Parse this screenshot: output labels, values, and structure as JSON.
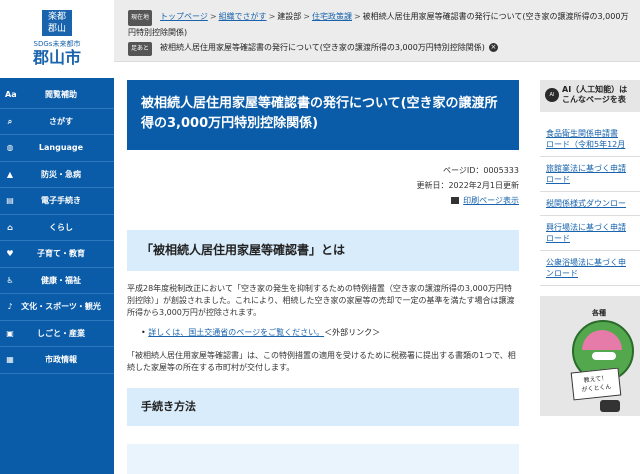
{
  "logo": {
    "mark_text": "楽都\n郡山",
    "sdgs": "SDGs未来都市",
    "name": "郡山市"
  },
  "sidebar": {
    "items": [
      {
        "label": "閲覧補助",
        "icon": "font-size-icon"
      },
      {
        "label": "さがす",
        "icon": "search-icon"
      },
      {
        "label": "Language",
        "icon": "globe-icon"
      },
      {
        "label": "防災・急病",
        "icon": "warning-icon"
      },
      {
        "label": "電子手続き",
        "icon": "document-icon"
      },
      {
        "label": "くらし",
        "icon": "house-icon"
      },
      {
        "label": "子育て・教育",
        "icon": "heart-icon"
      },
      {
        "label": "健康・福祉",
        "icon": "accessibility-icon"
      },
      {
        "label": "文化・スポーツ・観光",
        "icon": "music-note-icon"
      },
      {
        "label": "しごと・産業",
        "icon": "briefcase-icon"
      },
      {
        "label": "市政情報",
        "icon": "building-icon"
      }
    ]
  },
  "breadcrumb": {
    "badge": "現在地",
    "links": [
      "トップページ",
      "組織でさがす",
      "建設部",
      "住宅政策課"
    ],
    "current": "被相続人居住用家屋等確認書の発行について(空き家の譲渡所得の3,000万円特別控除関係)",
    "link_flags": [
      true,
      true,
      false,
      true
    ]
  },
  "from": {
    "badge": "足あと",
    "text": "被相続人居住用家屋等確認書の発行について(空き家の譲渡所得の3,000万円特別控除関係)"
  },
  "article": {
    "title": "被相続人居住用家屋等確認書の発行について(空き家の譲渡所得の3,000万円特別控除関係)",
    "page_id": "ページID：0005333",
    "updated": "更新日：2022年2月1日更新",
    "print_label": "印刷ページ表示",
    "h2": "「被相続人居住用家屋等確認書」とは",
    "para1": "平成28年度税制改正において「空き家の発生を抑制するための特例措置（空き家の譲渡所得の3,000万円特別控除）」が創設されました。これにより、相続した空き家の家屋等の売却で一定の基準を満たす場合は譲渡所得から3,000万円が控除されます。",
    "ext_link": "詳しくは、国土交通省のページをご覧ください。",
    "ext_suffix": "＜外部リンク＞",
    "para2": "「被相続人居住用家屋等確認書」は、この特例措置の適用を受けるために税務署に提出する書類の1つで、相続した家屋等の所在する市町村が交付します。",
    "h3": "手続き方法"
  },
  "right": {
    "ai_icon": "AI",
    "ai_text": "AI（人工知能）は\nこんなページを表",
    "links": [
      "食品衛生関係申請書\nロード（令和5年12月",
      "旅館業法に基づく申請\nロード",
      "税関係様式ダウンロー",
      "興行場法に基づく申請\nロード",
      "公衆浴場法に基づく申\nンロード"
    ],
    "gaku_head": "各種",
    "gaku_sign": "教えて！\nがくとくん"
  }
}
